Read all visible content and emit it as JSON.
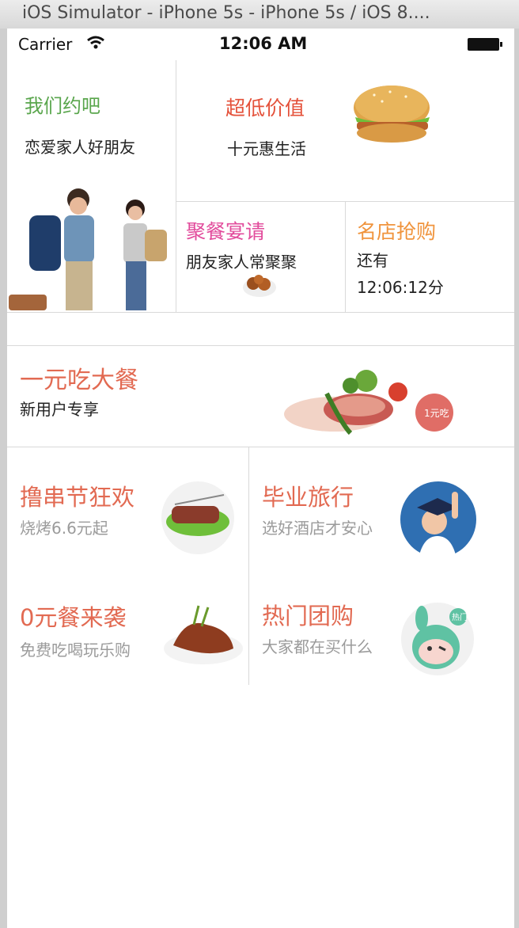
{
  "window": {
    "title": "iOS Simulator - iPhone 5s - iPhone 5s / iOS 8...."
  },
  "status_bar": {
    "carrier": "Carrier",
    "time": "12:06 AM"
  },
  "top_grid": {
    "date_block": {
      "title": "我们约吧",
      "subtitle": "恋爱家人好朋友"
    },
    "value_block": {
      "title": "超低价值",
      "subtitle": "十元惠生活"
    },
    "party_block": {
      "title": "聚餐宴请",
      "subtitle": "朋友家人常聚聚"
    },
    "flash_block": {
      "title": "名店抢购",
      "line1": "还有",
      "countdown": "12:06:12分"
    }
  },
  "promo_banner": {
    "title": "一元吃大餐",
    "subtitle": "新用户专享",
    "badge": "1元吃"
  },
  "tiles": [
    {
      "title": "撸串节狂欢",
      "subtitle": "烧烤6.6元起"
    },
    {
      "title": "毕业旅行",
      "subtitle": "选好酒店才安心"
    },
    {
      "title": "0元餐来袭",
      "subtitle": "免费吃喝玩乐购"
    },
    {
      "title": "热门团购",
      "subtitle": "大家都在买什么",
      "badge": "热门"
    }
  ],
  "colors": {
    "green": "#5aa64d",
    "red": "#e4513a",
    "pink": "#e24c9c",
    "orange": "#f0943d",
    "coral": "#e26a52"
  }
}
